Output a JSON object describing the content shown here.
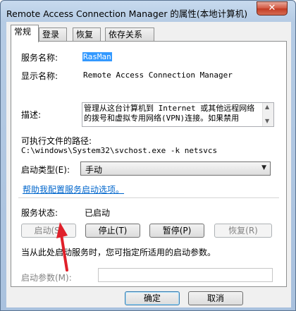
{
  "window": {
    "title": "Remote Access Connection Manager 的属性(本地计算机)",
    "close_glyph": "✕"
  },
  "tabs": [
    {
      "label": "常规"
    },
    {
      "label": "登录"
    },
    {
      "label": "恢复"
    },
    {
      "label": "依存关系"
    }
  ],
  "general": {
    "service_name_label": "服务名称:",
    "service_name_value": "RasMan",
    "display_name_label": "显示名称:",
    "display_name_value": "Remote Access Connection Manager",
    "description_label": "描述:",
    "description_value": "管理从这台计算机到 Internet 或其他远程网络的拨号和虚拟专用网络(VPN)连接。如果禁用",
    "exe_path_label": "可执行文件的路径:",
    "exe_path_value": "C:\\windows\\System32\\svchost.exe -k netsvcs",
    "startup_type_label": "启动类型(E):",
    "startup_type_value": "手动",
    "help_link": "帮助我配置服务启动选项。",
    "status_label": "服务状态:",
    "status_value": "已启动",
    "start_button": "启动(S)",
    "stop_button": "停止(T)",
    "pause_button": "暂停(P)",
    "resume_button": "恢复(R)",
    "hint_text": "当从此处启动服务时，您可指定所适用的启动参数。",
    "start_params_label": "启动参数(M):",
    "start_params_value": ""
  },
  "footer": {
    "ok_button": "确定",
    "cancel_button": "取消"
  },
  "icons": {
    "dropdown_arrow": "▼",
    "scroll_up": "▲",
    "scroll_down": "▼"
  },
  "colors": {
    "annotation_arrow": "#e0202a",
    "link": "#0066cc",
    "selection": "#3399ff"
  }
}
